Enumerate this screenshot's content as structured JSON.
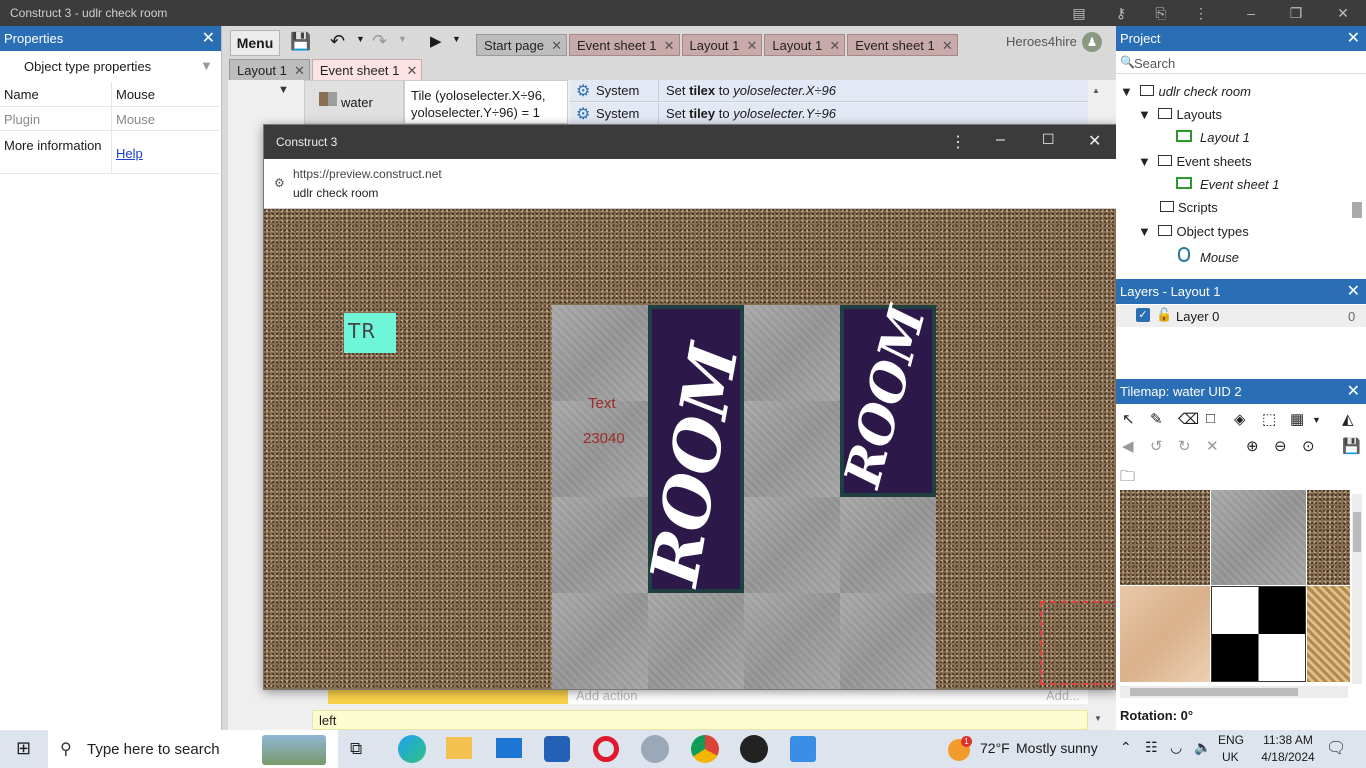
{
  "window": {
    "title": "Construct 3 - udlr check room"
  },
  "properties": {
    "title": "Properties",
    "section": "Object type properties",
    "rows": [
      {
        "label": "Name",
        "value": "Mouse"
      },
      {
        "label": "Plugin",
        "value": "Mouse"
      },
      {
        "label": "More information",
        "value": "Help"
      }
    ]
  },
  "toolbar": {
    "menu_label": "Menu",
    "user": "Heroes4hire"
  },
  "tabs": [
    {
      "label": "Start page",
      "style": "gray"
    },
    {
      "label": "Event sheet 1",
      "style": "normal"
    },
    {
      "label": "Layout 1",
      "style": "normal"
    },
    {
      "label": "Layout 1",
      "style": "normal"
    },
    {
      "label": "Event sheet 1",
      "style": "normal"
    }
  ],
  "tabs2": [
    {
      "label": "Layout 1",
      "style": "gray"
    },
    {
      "label": "Event sheet 1",
      "style": "active"
    }
  ],
  "event": {
    "object": "water",
    "condition": "Tile (yoloselecter.X÷96, yoloselecter.Y÷96) = 1",
    "actions": [
      {
        "obj": "System",
        "pre": "Set ",
        "var": "tilex",
        "mid": " to ",
        "expr": "yoloselecter.X÷96"
      },
      {
        "obj": "System",
        "pre": "Set ",
        "var": "tiley",
        "mid": " to ",
        "expr": "yoloselecter.Y÷96"
      }
    ],
    "add_action": "Add action",
    "add_more": "Add...",
    "bottom_text": "left"
  },
  "preview": {
    "title": "Construct 3",
    "url": "https://preview.construct.net",
    "page": "udlr check room",
    "tr_text": "TR",
    "text_label": "Text",
    "number": "23040",
    "door_word": "ROOM"
  },
  "project": {
    "title": "Project",
    "search_placeholder": "Search",
    "items": [
      {
        "label": "udlr check room",
        "italic": true
      },
      {
        "label": "Layouts",
        "italic": false
      },
      {
        "label": "Layout 1",
        "italic": true
      },
      {
        "label": "Event sheets",
        "italic": false
      },
      {
        "label": "Event sheet 1",
        "italic": true
      },
      {
        "label": "Scripts",
        "italic": false
      },
      {
        "label": "Object types",
        "italic": false
      },
      {
        "label": "Mouse",
        "italic": true
      }
    ]
  },
  "layers": {
    "title": "Layers - Layout 1",
    "layer": "Layer 0",
    "count": "0"
  },
  "tilemap": {
    "title": "Tilemap: water UID 2",
    "rotation": "Rotation: 0°"
  },
  "taskbar": {
    "search": "Type here to search",
    "temp": "72°F",
    "weather": "Mostly sunny",
    "lang1": "ENG",
    "lang2": "UK",
    "time": "11:38 AM",
    "date": "4/18/2024",
    "weather_badge": "1"
  }
}
